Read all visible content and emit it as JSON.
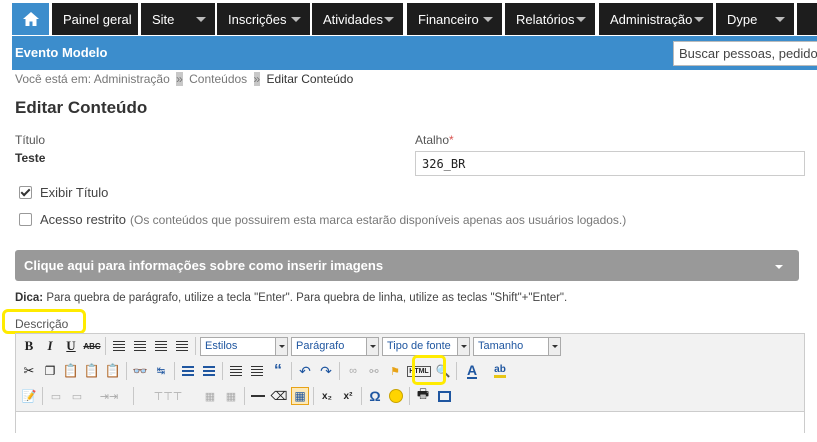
{
  "nav": {
    "items": [
      "Painel geral",
      "Site",
      "Inscrições",
      "Atividades",
      "Financeiro",
      "Relatórios",
      "Administração",
      "Dype"
    ]
  },
  "header": {
    "brand": "Evento Modelo",
    "search_placeholder": "Buscar pessoas, pedidos"
  },
  "breadcrumb": {
    "prefix": "Você está em:",
    "items": [
      "Administração",
      "Conteúdos"
    ],
    "current": "Editar Conteúdo",
    "separator": "»"
  },
  "page_title": "Editar Conteúdo",
  "form": {
    "titulo_label": "Título",
    "titulo_value": "Teste",
    "atalho_label": "Atalho",
    "atalho_required": "*",
    "atalho_value": "326_BR",
    "exibir_titulo_label": "Exibir Título",
    "exibir_titulo_checked": true,
    "acesso_restrito_label": "Acesso restrito",
    "acesso_restrito_hint": "(Os conteúdos que possuirem esta marca estarão disponíveis apenas aos usuários logados.)",
    "acesso_restrito_checked": false
  },
  "accordion": {
    "label": "Clique aqui para informações sobre como inserir imagens"
  },
  "tip": {
    "prefix": "Dica:",
    "text": "Para quebra de parágrafo, utilize a tecla \"Enter\". Para quebra de linha, utilize as teclas \"Shift\"+\"Enter\"."
  },
  "editor": {
    "label": "Descrição",
    "bold": "B",
    "italic": "I",
    "underline": "U",
    "strike": "ABC",
    "styles_combo": "Estilos",
    "format_combo": "Parágrafo",
    "font_combo": "Tipo de fonte",
    "size_combo": "Tamanho",
    "html_button": "HTML",
    "omega": "Ω",
    "subscript": "x₂",
    "superscript": "x²",
    "text_color": "A",
    "highlight": "ab"
  }
}
